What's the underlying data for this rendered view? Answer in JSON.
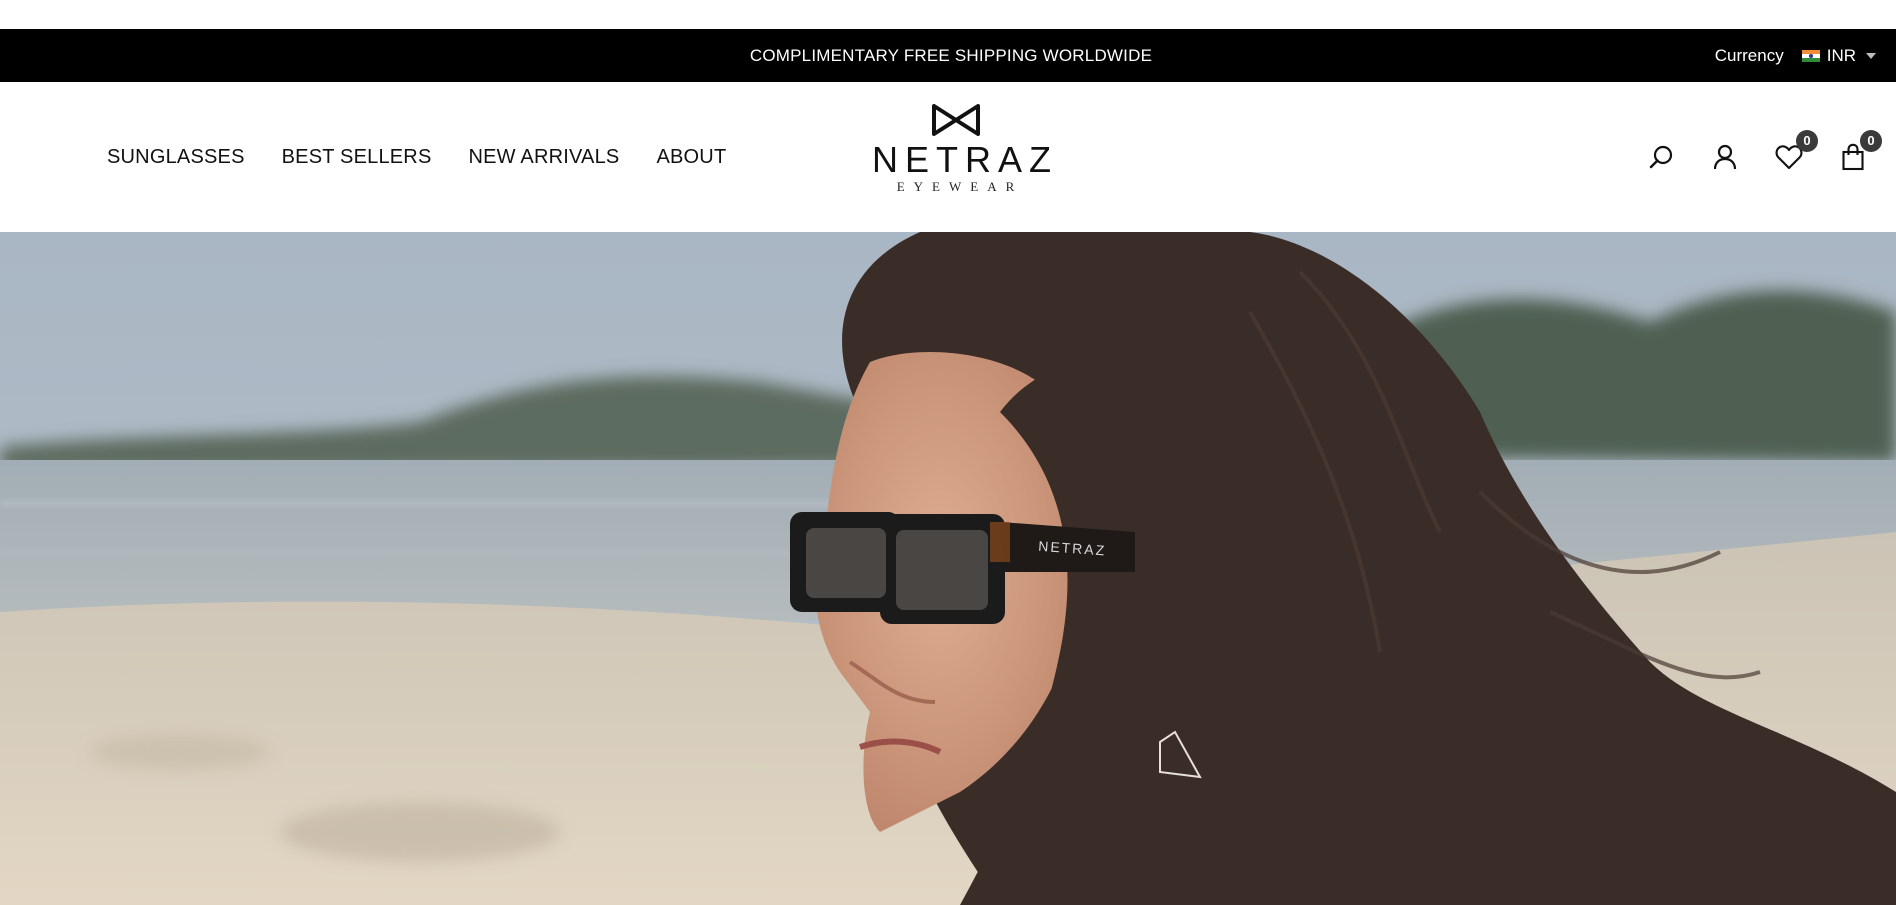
{
  "announcement": {
    "text": "COMPLIMENTARY FREE SHIPPING WORLDWIDE"
  },
  "currency": {
    "label": "Currency",
    "selected": "INR",
    "flag": "india-flag"
  },
  "nav": {
    "items": [
      {
        "label": "SUNGLASSES"
      },
      {
        "label": "BEST SELLERS"
      },
      {
        "label": "NEW ARRIVALS"
      },
      {
        "label": "ABOUT"
      }
    ]
  },
  "logo": {
    "word": "NETRAZ",
    "sub": "EYEWEAR"
  },
  "header_icons": {
    "search": "search-icon",
    "account": "user-icon",
    "wishlist": {
      "icon": "heart-icon",
      "count": "0"
    },
    "cart": {
      "icon": "shopping-bag-icon",
      "count": "0"
    }
  },
  "hero": {
    "image": "woman-wearing-black-sunglasses-on-beach",
    "glasses_text": "NETRAZ"
  },
  "colors": {
    "announcement_bg": "#000000",
    "badge_bg": "#3a3a3a",
    "text": "#111111"
  }
}
